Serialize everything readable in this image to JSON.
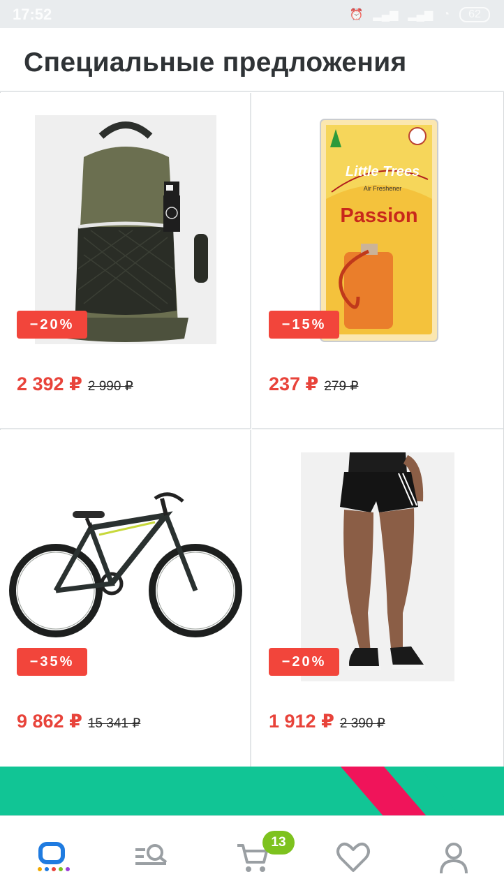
{
  "status_bar": {
    "time": "17:52",
    "battery": "62"
  },
  "header": {
    "title": "Специальные предложения"
  },
  "products": [
    {
      "name": "backpack",
      "image_icon": "backpack-icon",
      "discount": "−20%",
      "price": "2 392 ₽",
      "old_price": "2 990 ₽"
    },
    {
      "name": "air-freshener",
      "image_icon": "air-freshener-icon",
      "discount": "−15%",
      "price": "237 ₽",
      "old_price": "279 ₽"
    },
    {
      "name": "bicycle",
      "image_icon": "bicycle-icon",
      "discount": "−35%",
      "price": "9 862 ₽",
      "old_price": "15 341 ₽"
    },
    {
      "name": "shorts",
      "image_icon": "shorts-icon",
      "discount": "−20%",
      "price": "1 912 ₽",
      "old_price": "2 390 ₽"
    }
  ],
  "freshener_label": {
    "brand": "Little Trees",
    "sub": "Air Freshener",
    "scent": "Passion"
  },
  "nav": {
    "items": [
      "home-logo-icon",
      "catalog-search-icon",
      "cart-icon",
      "heart-icon",
      "profile-icon"
    ],
    "cart_count": "13"
  },
  "colors": {
    "accent": "#f2453b",
    "price": "#e8433a",
    "banner": "#11c595",
    "badge": "#7dc21e",
    "icon": "#9a9fa3"
  }
}
